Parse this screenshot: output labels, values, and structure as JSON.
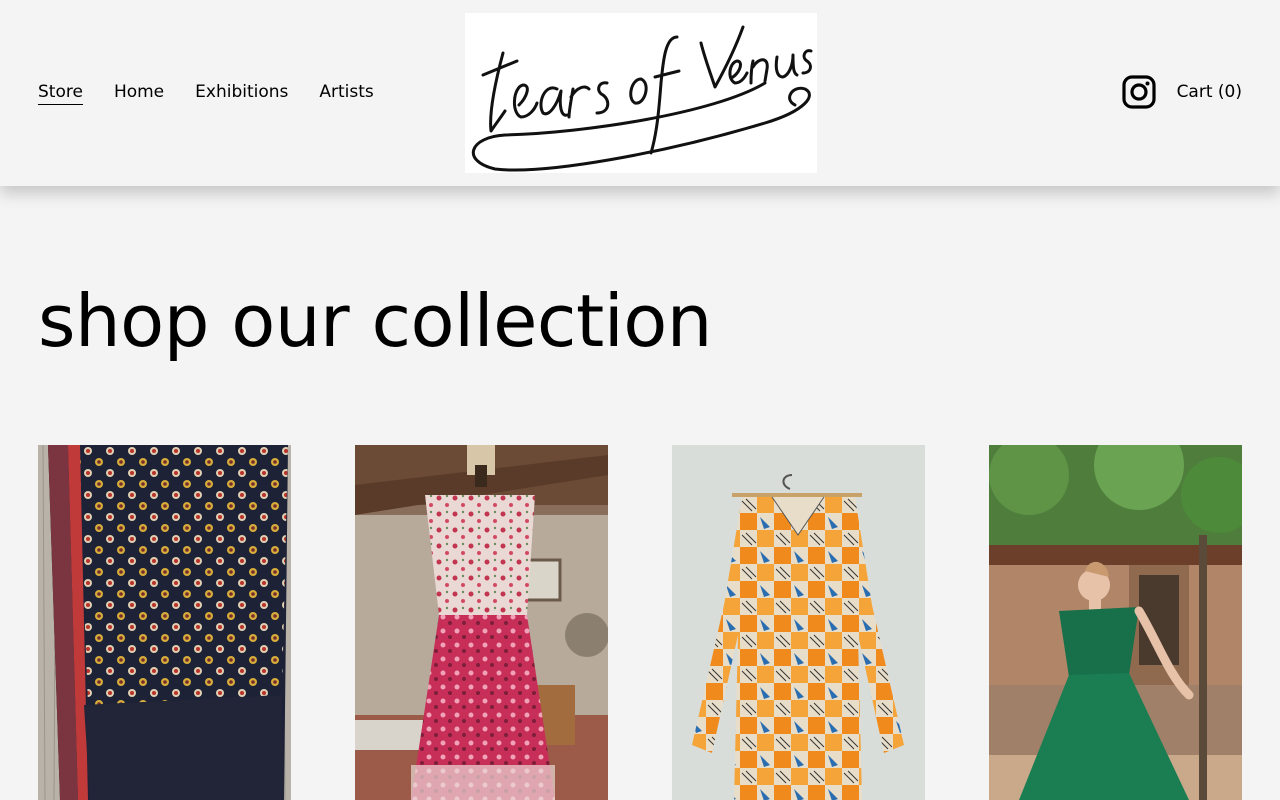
{
  "nav": {
    "items": [
      {
        "label": "Store",
        "active": true
      },
      {
        "label": "Home",
        "active": false
      },
      {
        "label": "Exhibitions",
        "active": false
      },
      {
        "label": "Artists",
        "active": false
      }
    ]
  },
  "logo": {
    "text": "tears of Venus",
    "alt": "Tears of Venus logo"
  },
  "header": {
    "instagram_icon": "instagram-icon",
    "cart_label": "Cart (0)"
  },
  "main": {
    "title": "shop our collection"
  },
  "products": [
    {
      "image": "embroidered mirror-work textile on wood"
    },
    {
      "image": "floral pink dress on dress form"
    },
    {
      "image": "orange and blue print mini dress on hanger"
    },
    {
      "image": "green velvet gown worn outdoors"
    }
  ],
  "colors": {
    "background": "#f4f4f4",
    "text": "#000000"
  }
}
